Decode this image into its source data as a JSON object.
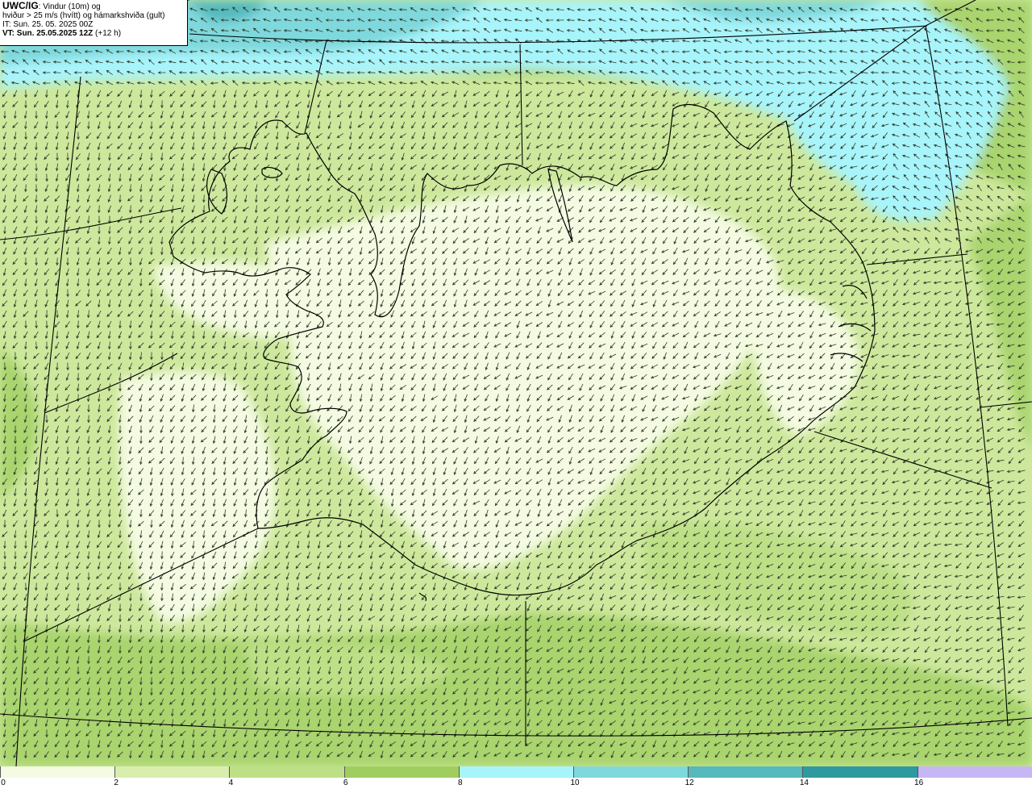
{
  "header": {
    "model": "UWC/IG",
    "title_line1": ": Vindur (10m) og",
    "title_line2": "hviður > 25 m/s (hvítt) og hámarkshviða (gult)",
    "init_time": "IT: Sun. 25. 05. 2025 00Z",
    "valid_prefix": "VT: Sun. 25.05.2025 12Z",
    "valid_suffix": " (+12 h)"
  },
  "colors": {
    "levels": [
      {
        "min": 0,
        "max": 2,
        "color": "#f4fbe2"
      },
      {
        "min": 2,
        "max": 4,
        "color": "#d9eeae"
      },
      {
        "min": 4,
        "max": 6,
        "color": "#bde087"
      },
      {
        "min": 6,
        "max": 8,
        "color": "#9fce5e"
      },
      {
        "min": 8,
        "max": 10,
        "color": "#a8f4fb"
      },
      {
        "min": 10,
        "max": 12,
        "color": "#7fd8dc"
      },
      {
        "min": 12,
        "max": 14,
        "color": "#55b9bd"
      },
      {
        "min": 14,
        "max": 16,
        "color": "#2e9a9f"
      },
      {
        "min": 16,
        "max": 18,
        "color": "#c7b6f5"
      }
    ],
    "coastline": "#000000",
    "arrow": "#303a2a"
  },
  "colorbar": {
    "labels": [
      "0",
      "2",
      "4",
      "6",
      "8",
      "10",
      "12",
      "14",
      "16"
    ]
  }
}
